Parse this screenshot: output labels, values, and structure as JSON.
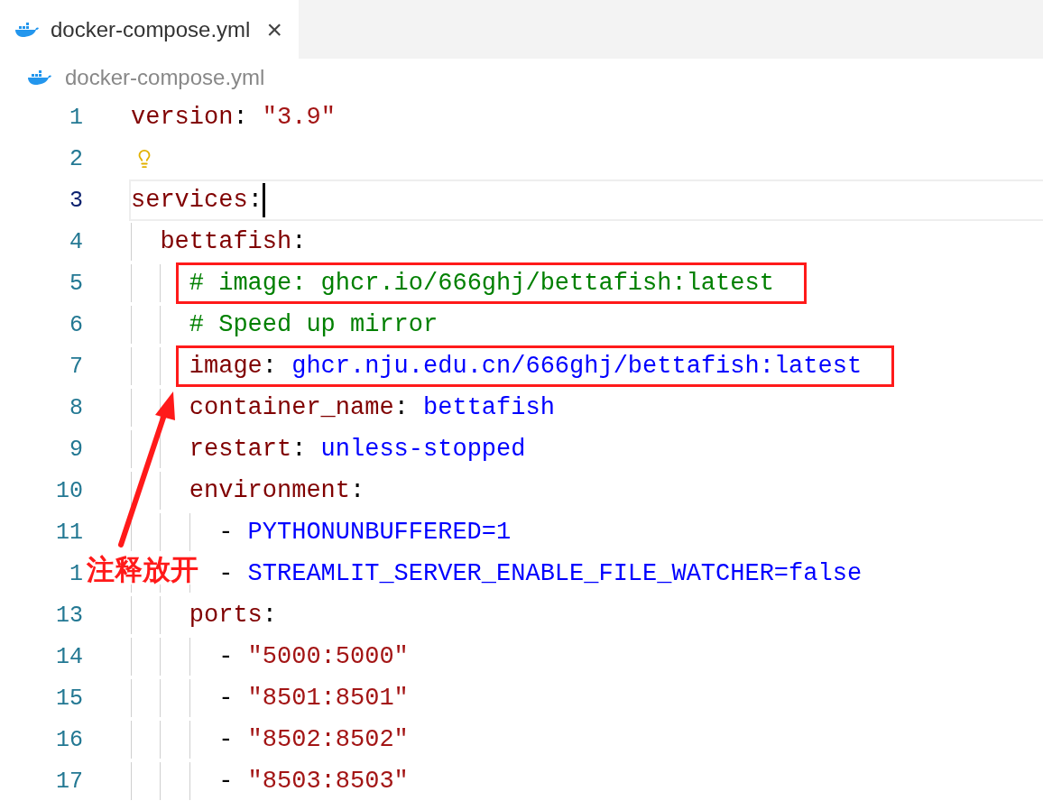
{
  "tabs": [
    {
      "label": "docker-compose.yml",
      "selected": true,
      "close": "×"
    }
  ],
  "breadcrumb": "docker-compose.yml",
  "lines": [
    {
      "number": "1",
      "current": false,
      "lightbulb": false,
      "boxed": false,
      "tokens": [
        {
          "kind": "key",
          "text": "version"
        },
        {
          "kind": "punct",
          "text": ": "
        },
        {
          "kind": "string",
          "text": "\"3.9\""
        }
      ]
    },
    {
      "number": "2",
      "current": false,
      "lightbulb": true,
      "boxed": false
    },
    {
      "number": "3",
      "current": true,
      "lightbulb": false,
      "boxed": false,
      "tokens": [
        {
          "kind": "key",
          "text": "services"
        },
        {
          "kind": "punct",
          "text": ":"
        }
      ],
      "children": [
        {
          "number": "4",
          "current": false,
          "lightbulb": false,
          "boxed": false,
          "tokens": [
            {
              "kind": "key",
              "text": "bettafish"
            },
            {
              "kind": "punct",
              "text": ":"
            }
          ],
          "children": [
            {
              "number": "5",
              "current": false,
              "lightbulb": false,
              "boxed": true,
              "tokens": [
                {
                  "kind": "comment",
                  "text": "# image: ghcr.io/666ghj/bettafish:latest"
                }
              ]
            },
            {
              "number": "6",
              "current": false,
              "lightbulb": false,
              "boxed": false,
              "tokens": [
                {
                  "kind": "comment",
                  "text": "# Speed up mirror"
                }
              ]
            },
            {
              "number": "7",
              "current": false,
              "lightbulb": false,
              "boxed": true,
              "tokens": [
                {
                  "kind": "key",
                  "text": "image"
                },
                {
                  "kind": "punct",
                  "text": ": "
                },
                {
                  "kind": "value",
                  "text": "ghcr.nju.edu.cn/666ghj/bettafish:latest"
                }
              ]
            },
            {
              "number": "8",
              "current": false,
              "lightbulb": false,
              "boxed": false,
              "tokens": [
                {
                  "kind": "key",
                  "text": "container_name"
                },
                {
                  "kind": "punct",
                  "text": ": "
                },
                {
                  "kind": "value",
                  "text": "bettafish"
                }
              ]
            },
            {
              "number": "9",
              "current": false,
              "lightbulb": false,
              "boxed": false,
              "tokens": [
                {
                  "kind": "key",
                  "text": "restart"
                },
                {
                  "kind": "punct",
                  "text": ": "
                },
                {
                  "kind": "value",
                  "text": "unless-stopped"
                }
              ]
            },
            {
              "number": "10",
              "current": false,
              "lightbulb": false,
              "boxed": false,
              "tokens": [
                {
                  "kind": "key",
                  "text": "environment"
                },
                {
                  "kind": "punct",
                  "text": ":"
                }
              ],
              "children": [
                {
                  "number": "11",
                  "current": false,
                  "lightbulb": false,
                  "boxed": false,
                  "tokens": [
                    {
                      "kind": "punct",
                      "text": "- "
                    },
                    {
                      "kind": "value",
                      "text": "PYTHONUNBUFFERED=1"
                    }
                  ]
                },
                {
                  "number": "1",
                  "current": false,
                  "lightbulb": false,
                  "boxed": false,
                  "tokens": [
                    {
                      "kind": "punct",
                      "text": "- "
                    },
                    {
                      "kind": "value",
                      "text": "STREAMLIT_SERVER_ENABLE_FILE_WATCHER=false"
                    }
                  ]
                }
              ]
            },
            {
              "number": "13",
              "current": false,
              "lightbulb": false,
              "boxed": false,
              "tokens": [
                {
                  "kind": "key",
                  "text": "ports"
                },
                {
                  "kind": "punct",
                  "text": ":"
                }
              ],
              "children": [
                {
                  "number": "14",
                  "current": false,
                  "lightbulb": false,
                  "boxed": false,
                  "tokens": [
                    {
                      "kind": "punct",
                      "text": "- "
                    },
                    {
                      "kind": "string",
                      "text": "\"5000:5000\""
                    }
                  ]
                },
                {
                  "number": "15",
                  "current": false,
                  "lightbulb": false,
                  "boxed": false,
                  "tokens": [
                    {
                      "kind": "punct",
                      "text": "- "
                    },
                    {
                      "kind": "string",
                      "text": "\"8501:8501\""
                    }
                  ]
                },
                {
                  "number": "16",
                  "current": false,
                  "lightbulb": false,
                  "boxed": false,
                  "tokens": [
                    {
                      "kind": "punct",
                      "text": "- "
                    },
                    {
                      "kind": "string",
                      "text": "\"8502:8502\""
                    }
                  ]
                },
                {
                  "number": "17",
                  "current": false,
                  "lightbulb": false,
                  "boxed": false,
                  "tokens": [
                    {
                      "kind": "punct",
                      "text": "- "
                    },
                    {
                      "kind": "string",
                      "text": "\"8503:8503\""
                    }
                  ]
                }
              ]
            }
          ]
        }
      ]
    }
  ],
  "annotation": {
    "label": "注释放开"
  }
}
